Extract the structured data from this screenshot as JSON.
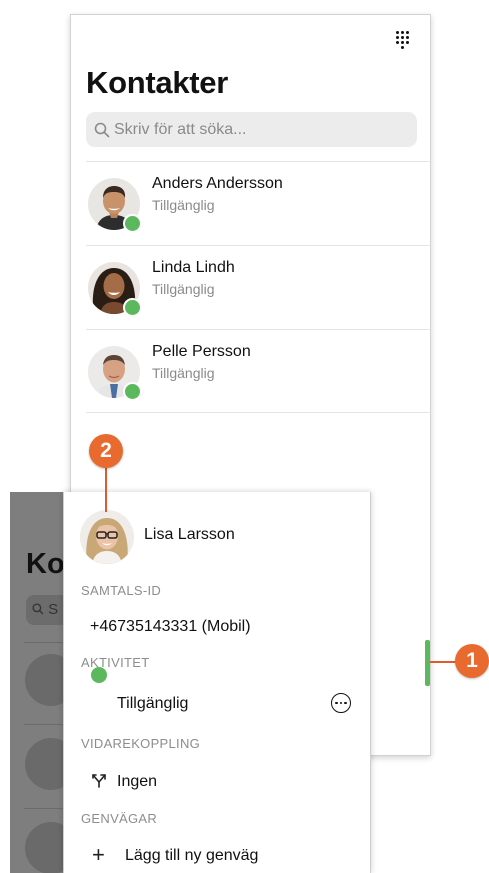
{
  "main_screen": {
    "title": "Kontakter",
    "search_placeholder": "Skriv för att söka...",
    "contacts": [
      {
        "name": "Anders Andersson",
        "status": "Tillgänglig"
      },
      {
        "name": "Linda Lindh",
        "status": "Tillgänglig"
      },
      {
        "name": "Pelle Persson",
        "status": "Tillgänglig"
      }
    ]
  },
  "background_screen": {
    "title_partial": "Ko",
    "search_partial": "S"
  },
  "panel": {
    "user_name": "Lisa Larsson",
    "call_id_heading": "SAMTALS-ID",
    "call_id_value": "+46735143331 (Mobil)",
    "activity_heading": "AKTIVITET",
    "activity_value": "Tillgänglig",
    "forwarding_heading": "VIDAREKOPPLING",
    "forwarding_value": "Ingen",
    "shortcuts_heading": "GENVÄGAR",
    "add_shortcut": "Lägg till ny genväg"
  },
  "callouts": {
    "one": "1",
    "two": "2"
  },
  "colors": {
    "status_green": "#5cb85c",
    "callout_orange": "#e86a2e"
  },
  "icons": [
    "dialpad-icon",
    "search-icon",
    "more-options-icon",
    "call-forward-icon",
    "plus-icon"
  ]
}
